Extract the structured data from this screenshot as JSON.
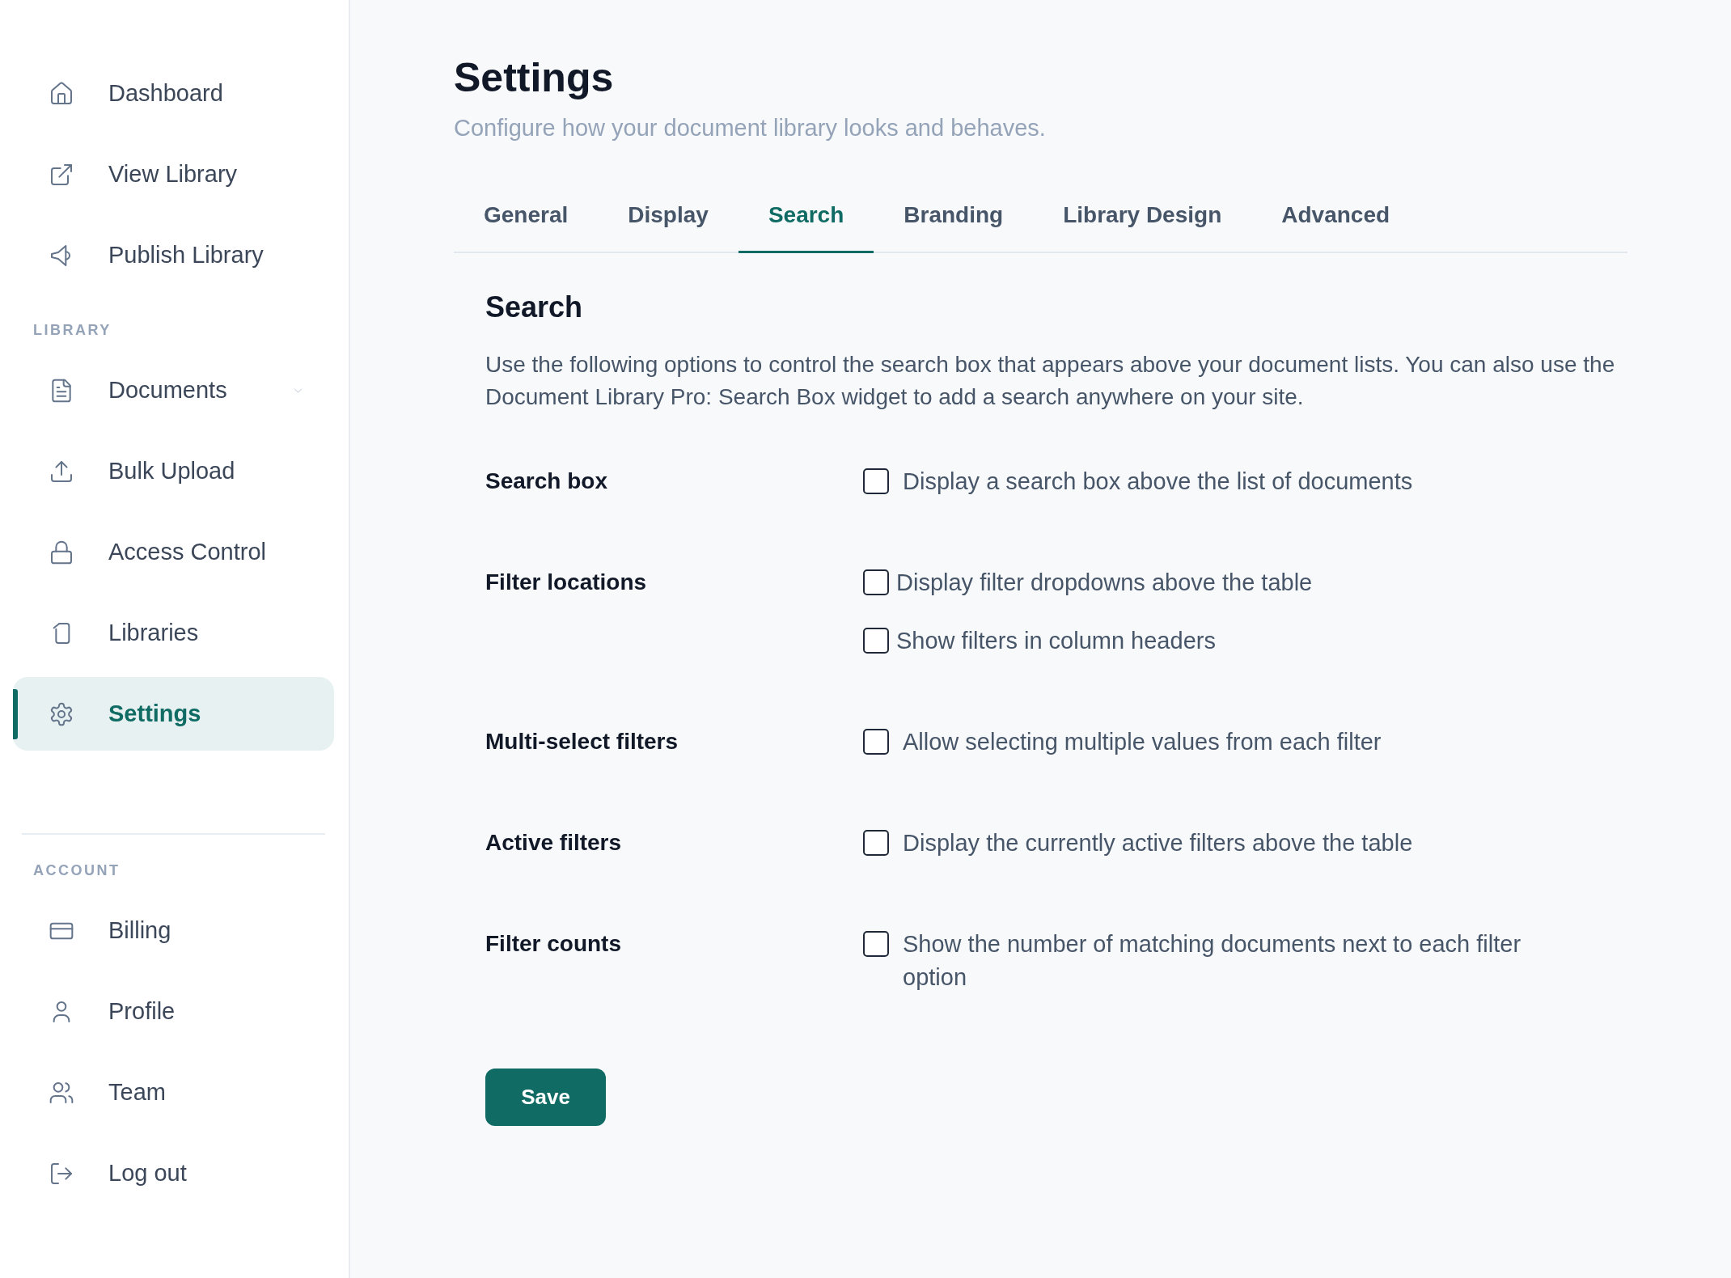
{
  "sidebar": {
    "sections": [
      {
        "items": [
          {
            "label": "Dashboard",
            "kind": "link",
            "selected": false
          },
          {
            "label": "View Library",
            "kind": "link",
            "selected": false
          },
          {
            "label": "Publish Library",
            "kind": "link",
            "selected": false
          }
        ]
      },
      {
        "heading": "LIBRARY",
        "items": [
          {
            "label": "Documents",
            "kind": "expandable",
            "selected": false
          },
          {
            "label": "Bulk Upload",
            "kind": "link",
            "selected": false
          },
          {
            "label": "Access Control",
            "kind": "link",
            "selected": false
          },
          {
            "label": "Libraries",
            "kind": "link",
            "selected": false
          },
          {
            "label": "Settings",
            "kind": "link",
            "selected": true
          }
        ]
      },
      {
        "heading": "ACCOUNT",
        "divider": true,
        "items": [
          {
            "label": "Billing",
            "kind": "link",
            "selected": false
          },
          {
            "label": "Profile",
            "kind": "link",
            "selected": false
          },
          {
            "label": "Team",
            "kind": "link",
            "selected": false
          },
          {
            "label": "Log out",
            "kind": "link",
            "selected": false
          }
        ]
      }
    ]
  },
  "page": {
    "title": "Settings",
    "subtitle": "Configure how your document library looks and behaves."
  },
  "tabs": [
    {
      "label": "General",
      "selected": false
    },
    {
      "label": "Display",
      "selected": false
    },
    {
      "label": "Search",
      "selected": true
    },
    {
      "label": "Branding",
      "selected": false
    },
    {
      "label": "Library Design",
      "selected": false
    },
    {
      "label": "Advanced",
      "selected": false
    }
  ],
  "panel": {
    "title": "Search",
    "description": "Use the following options to control the search box that appears above your document lists. You can also use the Document Library Pro: Search Box widget to add a search anywhere on your site.",
    "settings": [
      {
        "label": "Search box",
        "options": [
          {
            "label": "Display a search box above the list of documents",
            "checked": false
          }
        ]
      },
      {
        "label": "Filter locations",
        "options": [
          {
            "label": "Display filter dropdowns above the table",
            "checked": false
          },
          {
            "label": "Show filters in column headers",
            "checked": false
          }
        ]
      },
      {
        "label": "Multi-select filters",
        "options": [
          {
            "label": "Allow selecting multiple values from each filter",
            "checked": false
          }
        ]
      },
      {
        "label": "Active filters",
        "options": [
          {
            "label": "Display the currently active filters above the table",
            "checked": false
          }
        ]
      },
      {
        "label": "Filter counts",
        "options": [
          {
            "label": "Show the number of matching documents next to each filter option",
            "checked": false
          }
        ]
      }
    ],
    "save_button": {
      "label": "Save"
    }
  }
}
